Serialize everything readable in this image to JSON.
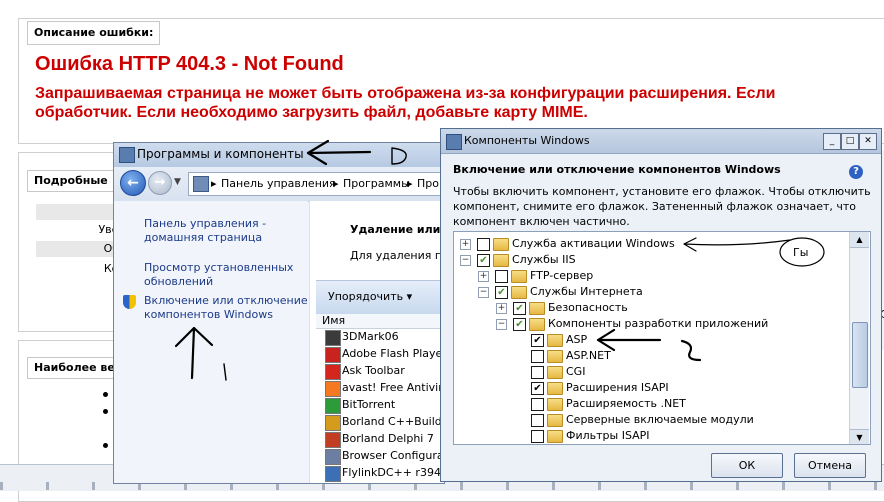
{
  "error_page": {
    "section_header": "Описание ошибки:",
    "title": "Ошибка HTTP 404.3 - Not Found",
    "message_line1": "Запрашиваемая страница не может быть отображена из-за конфигурации расширения. Если",
    "message_line2": "обработчик. Если необходимо загрузить файл, добавьте карту MIME.",
    "details_header": "Подробные",
    "details_rows": [
      "",
      "Увед",
      "Обр",
      "Код"
    ],
    "most_likely_header": "Наиболее ве",
    "right_fragment_1": "С",
    "right_fragment_2": "С"
  },
  "programs_window": {
    "title": "Программы и компоненты",
    "breadcrumbs": [
      "Панель управления",
      "Программы",
      "Прог"
    ],
    "left_links": [
      "Панель управления - домашняя страница",
      "Просмотр установленных обновлений",
      "Включение или отключение компонентов Windows"
    ],
    "remove_title": "Удаление или и",
    "remove_text": "Для удаления прог",
    "organize_label": "Упорядочить",
    "column_name": "Имя",
    "programs": [
      {
        "name": "3DMark06",
        "icon": "3dmark-icon",
        "color": "#3b3b3b"
      },
      {
        "name": "Adobe Flash Player",
        "icon": "flash-icon",
        "color": "#c8231f"
      },
      {
        "name": "Ask Toolbar",
        "icon": "ask-icon",
        "color": "#d5261d"
      },
      {
        "name": "avast! Free Antivirus",
        "icon": "avast-icon",
        "color": "#f47920"
      },
      {
        "name": "BitTorrent",
        "icon": "bittorrent-icon",
        "color": "#2c9b3a"
      },
      {
        "name": "Borland C++Builder",
        "icon": "borland-cpp-icon",
        "color": "#d49b1d"
      },
      {
        "name": "Borland Delphi 7",
        "icon": "borland-delphi-icon",
        "color": "#c23d21"
      },
      {
        "name": "Browser Configuratio",
        "icon": "browser-config-icon",
        "color": "#6c7fa3"
      },
      {
        "name": "FlylinkDC++ r394 bu",
        "icon": "flylink-icon",
        "color": "#3b6fb6"
      },
      {
        "name": "",
        "icon": "app-icon",
        "color": "#8c8c8c"
      }
    ]
  },
  "components_dialog": {
    "title": "Компоненты Windows",
    "heading": "Включение или отключение компонентов Windows",
    "description": "Чтобы включить компонент, установите его флажок. Чтобы отключить компонент, снимите его флажок. Затененный флажок означает, что компонент включен частично.",
    "tree": [
      {
        "label": "Служба активации Windows",
        "expander": "+",
        "state": "off"
      },
      {
        "label": "Службы IIS",
        "expander": "−",
        "state": "partial"
      },
      {
        "label": "FTP-сервер",
        "expander": "+",
        "state": "off"
      },
      {
        "label": "Службы Интернета",
        "expander": "−",
        "state": "partial"
      },
      {
        "label": "Безопасность",
        "expander": "+",
        "state": "partial"
      },
      {
        "label": "Компоненты разработки приложений",
        "expander": "−",
        "state": "partial"
      },
      {
        "label": "ASP",
        "expander": "",
        "state": "on"
      },
      {
        "label": "ASP.NET",
        "expander": "",
        "state": "off"
      },
      {
        "label": "CGI",
        "expander": "",
        "state": "off"
      },
      {
        "label": "Расширения ISAPI",
        "expander": "",
        "state": "on"
      },
      {
        "label": "Расширяемость .NET",
        "expander": "",
        "state": "off"
      },
      {
        "label": "Серверные включаемые модули",
        "expander": "",
        "state": "off"
      },
      {
        "label": "Фильтры ISAPI",
        "expander": "",
        "state": "off"
      }
    ],
    "ok_label": "ОК",
    "cancel_label": "Отмена",
    "help_glyph": "?"
  },
  "annotations": {
    "letter_d": "D",
    "note_gy": "Гы",
    "mark_1": "1"
  }
}
